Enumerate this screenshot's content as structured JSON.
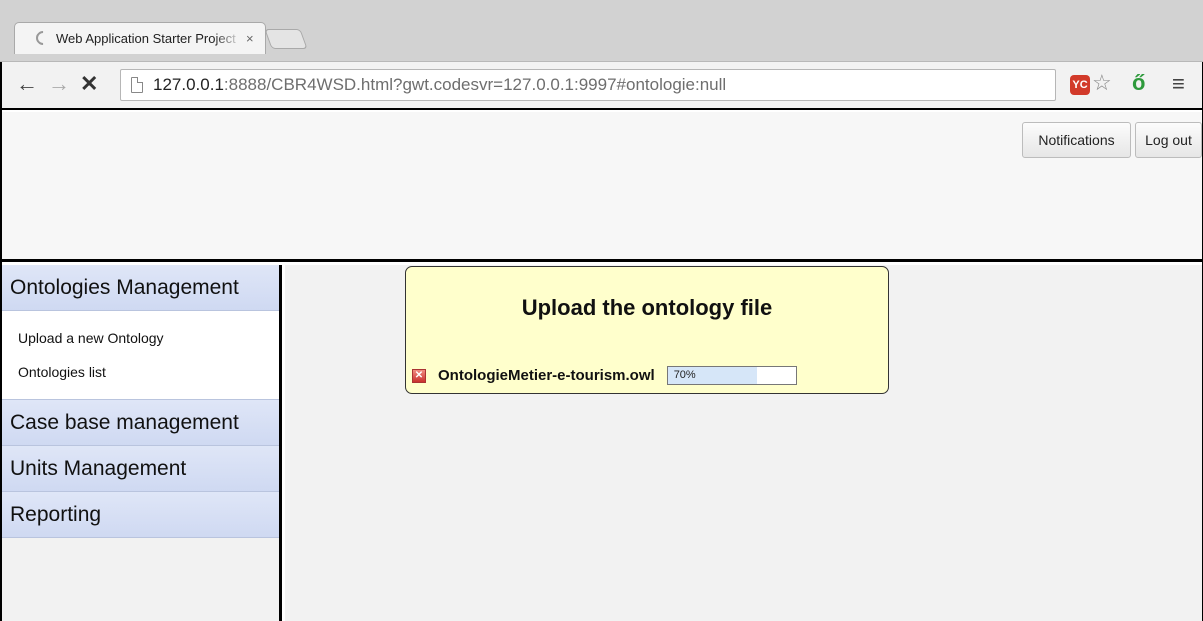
{
  "browser": {
    "tab_title": "Web Application Starter Project",
    "tab_close": "×",
    "url_host": "127.0.0.1",
    "url_rest": ":8888/CBR4WSD.html?gwt.codesvr=127.0.0.1:9997#ontologie:null",
    "ext_badge": "YC"
  },
  "header": {
    "notifications_label": "Notifications",
    "logout_label": "Log out"
  },
  "sidebar": {
    "sections": [
      {
        "label": "Ontologies Management",
        "items": [
          "Upload a new Ontology",
          "Ontologies list"
        ]
      },
      {
        "label": "Case base management"
      },
      {
        "label": "Units Management"
      },
      {
        "label": "Reporting"
      }
    ]
  },
  "upload_dialog": {
    "title": "Upload the ontology file",
    "file_name": "OntologieMetier-e-tourism.owl",
    "progress_text": "70%",
    "progress_value": 0.7
  }
}
